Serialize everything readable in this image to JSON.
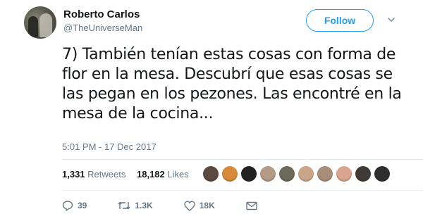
{
  "user": {
    "name": "Roberto Carlos",
    "handle": "@TheUniverseMan"
  },
  "follow_label": "Follow",
  "tweet": {
    "text": "7) También tenían estas cosas con forma de flor en la mesa. Descubrí que esas cosas se las pegan en los pezones. Las encontré en la mesa de la cocina...",
    "timestamp": "5:01 PM - 17 Dec 2017"
  },
  "stats": {
    "retweets_count": "1,331",
    "retweets_label": "Retweets",
    "likes_count": "18,182",
    "likes_label": "Likes"
  },
  "liker_colors": [
    "#5a4a40",
    "#d68a3a",
    "#222222",
    "#b59a86",
    "#6b6b5a",
    "#caa58a",
    "#a88d78",
    "#d9a48c",
    "#3f3a36",
    "#2e2e2e"
  ],
  "actions": {
    "replies": "39",
    "retweets": "1.3K",
    "likes": "18K"
  },
  "colors": {
    "accent": "#1da1f2",
    "text": "#14171a",
    "muted": "#657786"
  }
}
